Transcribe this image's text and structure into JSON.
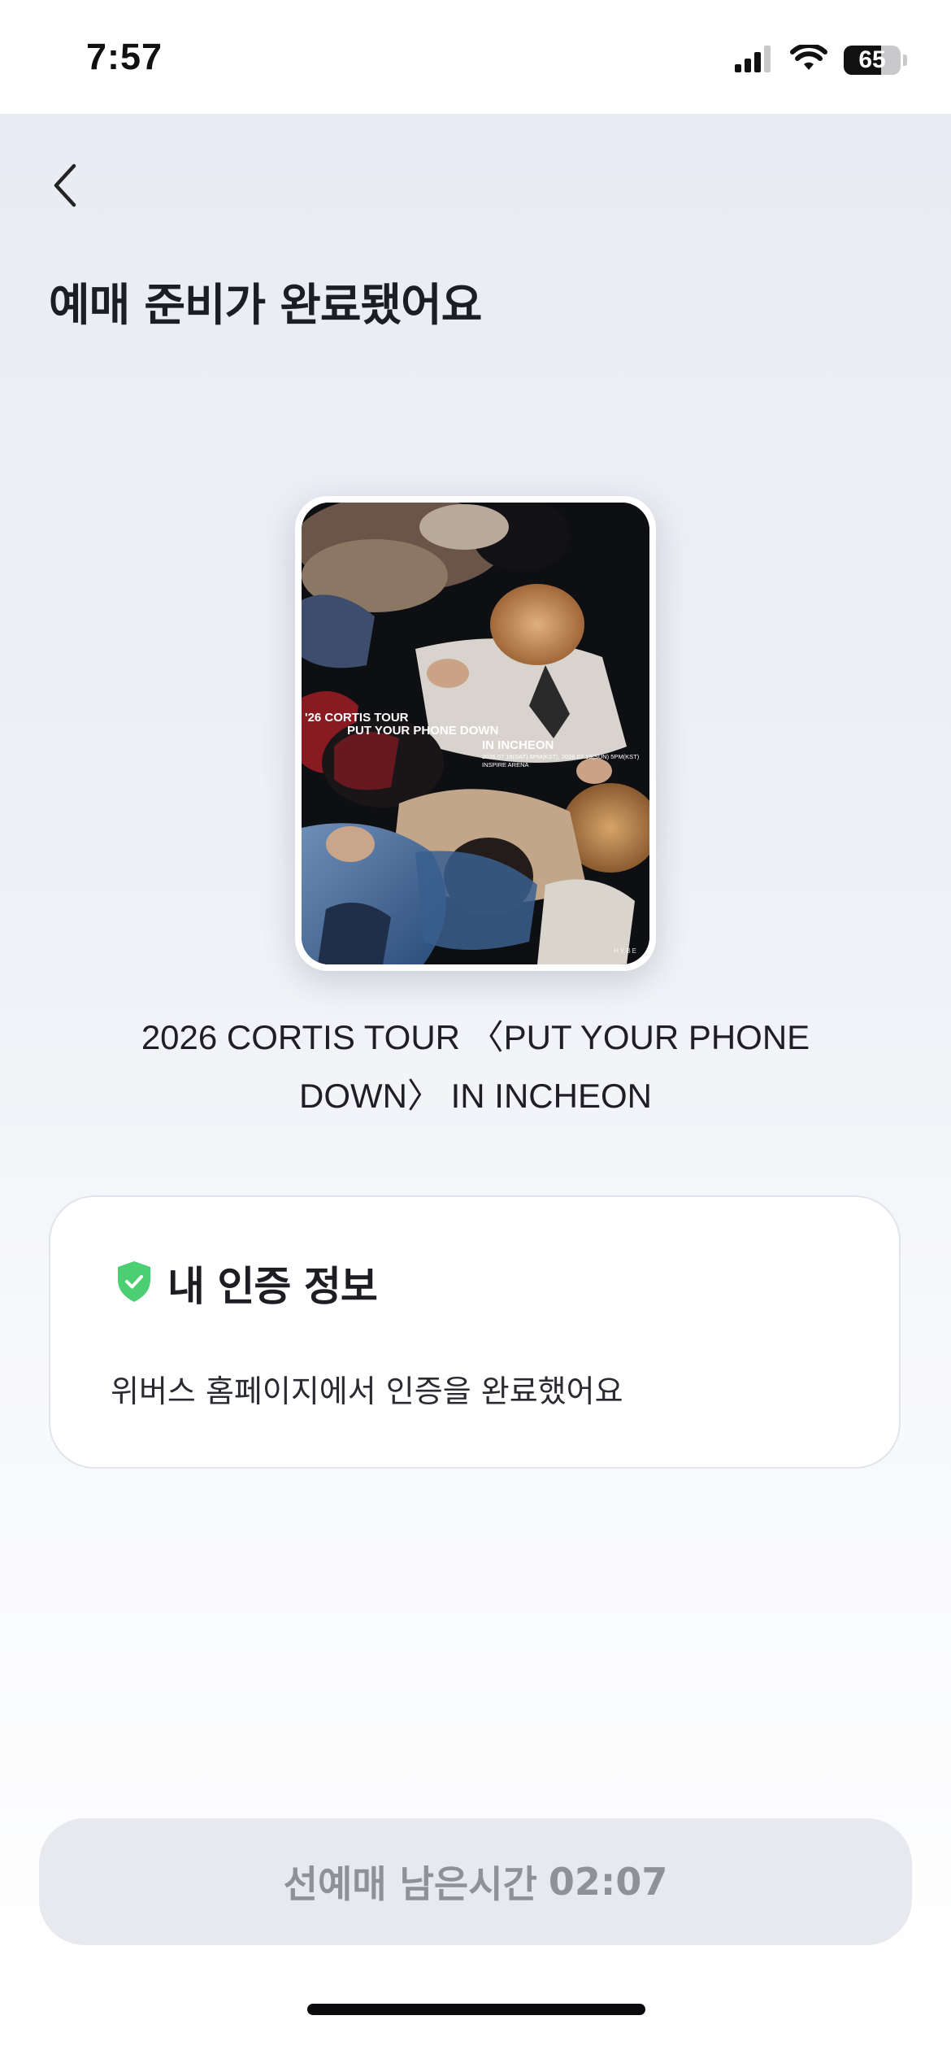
{
  "status_bar": {
    "time": "7:57",
    "battery_level": "65",
    "battery_fraction": 0.65
  },
  "header": {
    "back_icon": "chevron-left-icon",
    "title": "예매 준비가 완료됐어요"
  },
  "poster": {
    "line1": "'26 CORTIS TOUR",
    "line2": "PUT YOUR PHONE DOWN",
    "line3": "IN INCHEON",
    "line4": "2026.07.18(SAT) 6PM(KST), 2026.07.19(SUN) 5PM(KST)",
    "line5": "INSPIRE ARENA",
    "logo": "HYBE"
  },
  "event": {
    "title": "2026 CORTIS TOUR 〈PUT YOUR PHONE DOWN〉 IN INCHEON"
  },
  "auth_card": {
    "icon": "shield-check-icon",
    "icon_color": "#4cce73",
    "title": "내 인증 정보",
    "description": "위버스 홈페이지에서 인증을 완료했어요"
  },
  "presale": {
    "label": "선예매 남은시간",
    "time": "02:07"
  }
}
